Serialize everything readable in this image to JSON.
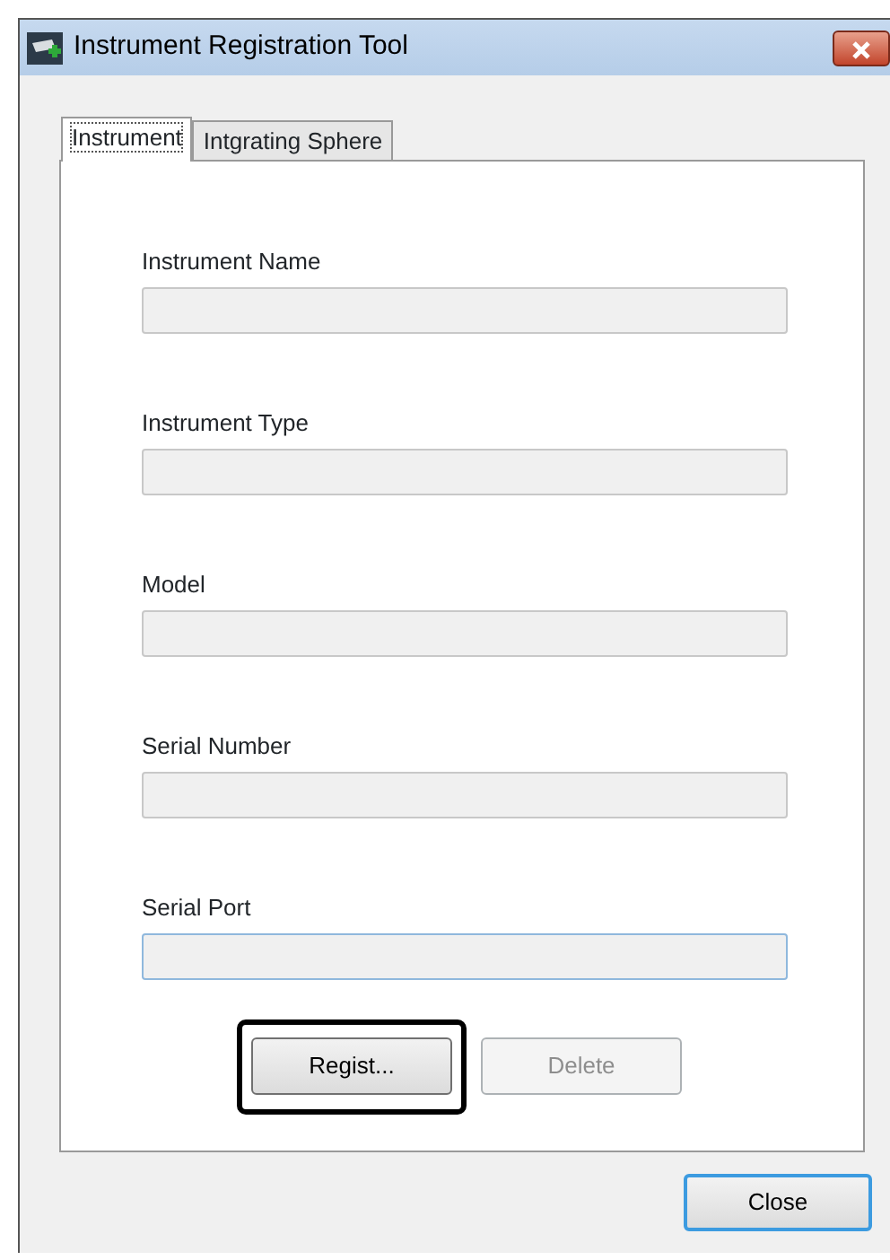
{
  "window": {
    "title": "Instrument Registration Tool"
  },
  "tabs": [
    {
      "label": "Instrument",
      "selected": true
    },
    {
      "label": "Intgrating Sphere",
      "selected": false
    }
  ],
  "fields": [
    {
      "label": "Instrument Name",
      "focused": false
    },
    {
      "label": "Instrument Type",
      "focused": false
    },
    {
      "label": "Model",
      "focused": false
    },
    {
      "label": "Serial Number",
      "focused": false
    },
    {
      "label": "Serial Port",
      "focused": true
    }
  ],
  "buttons": [
    {
      "label": "Regist...",
      "disabled": false,
      "highlighted": true
    },
    {
      "label": "Delete",
      "disabled": true,
      "highlighted": false
    }
  ],
  "close_button": {
    "label": "Close"
  }
}
